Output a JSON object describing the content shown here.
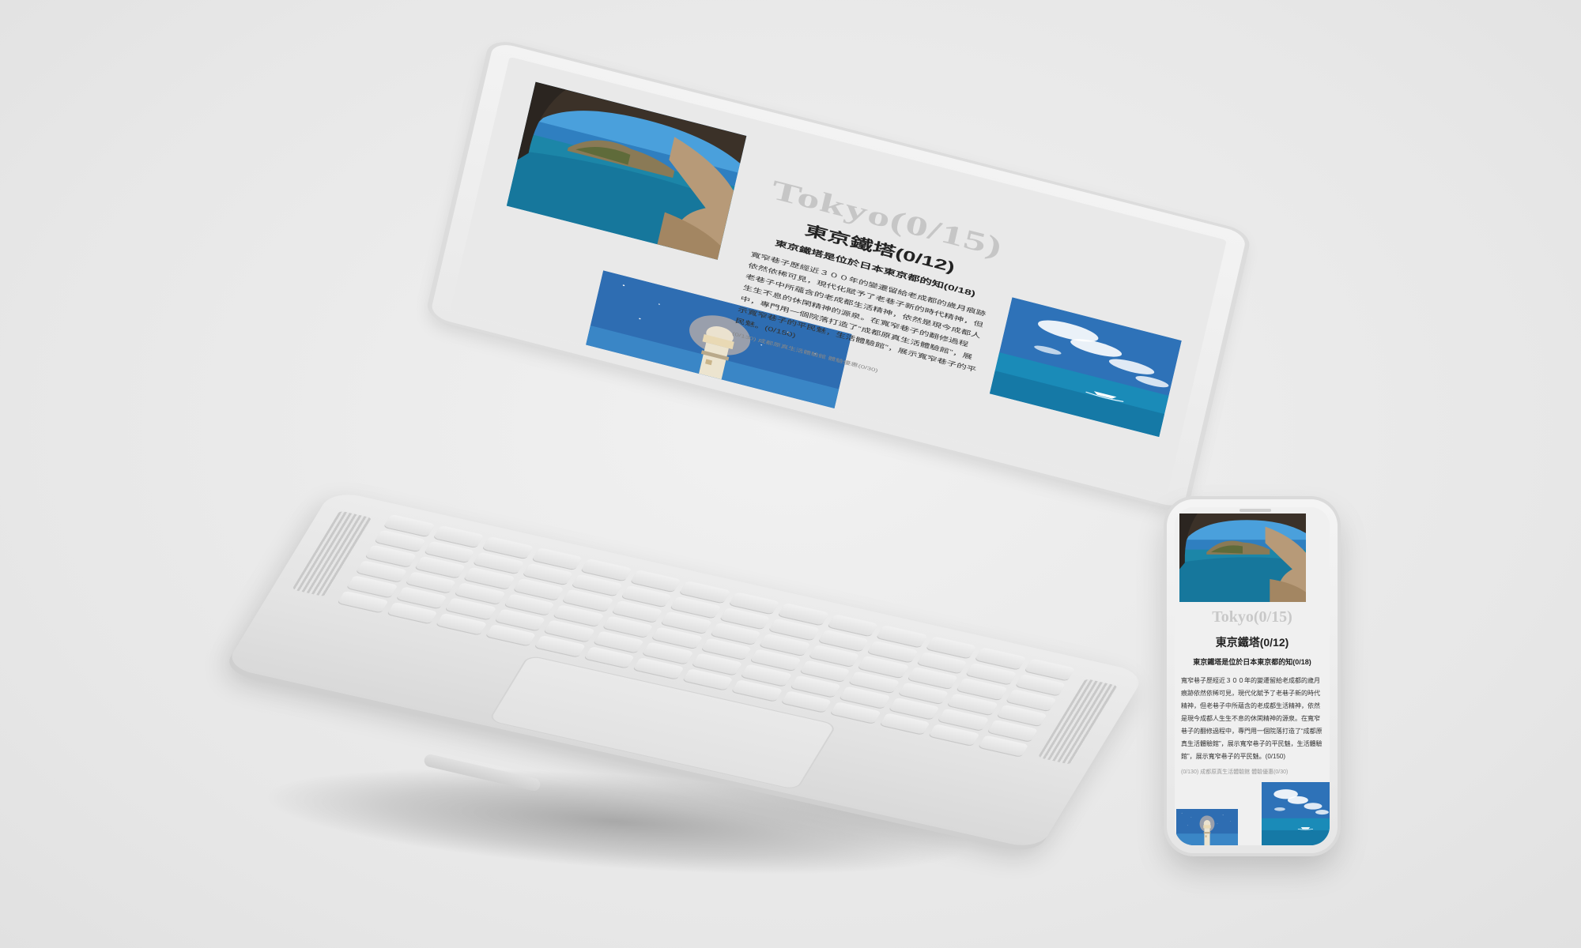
{
  "page": {
    "city_title": "Tokyo(0/15)",
    "heading": "東京鐵塔(0/12)",
    "subheading": "東京鐵塔是位於日本東京都的知(0/18)",
    "body": "寬窄巷子歷經近３００年的變遷留給老成都的歲月痕跡依然依稀可見，現代化賦予了老巷子新的時代精神，但老巷子中所蘊含的老成都生活精神，依然是現今成都人生生不息的休閑精神的源泉。在寬窄巷子的翻修過程中，專門用一個院落打造了“成都原真生活體驗館”，展示寬窄巷子的平民魅，生活體驗館”，展示寬窄巷子的平民魅。(0/150)",
    "caption": "(0/130) 成都原真生活體驗館 體驗優惠(0/30)"
  },
  "images": {
    "sea_cave": "sea-cave-photo",
    "lighthouse": "lighthouse-photo",
    "sea_boat": "sea-boat-photo"
  },
  "colors": {
    "background": "#e7e7e7",
    "device_body": "#e9e9e9",
    "sea": "#1f7fa8",
    "sky": "#2e6fb4",
    "city_title": "#c6c6c6"
  },
  "devices": [
    "laptop",
    "phone"
  ]
}
